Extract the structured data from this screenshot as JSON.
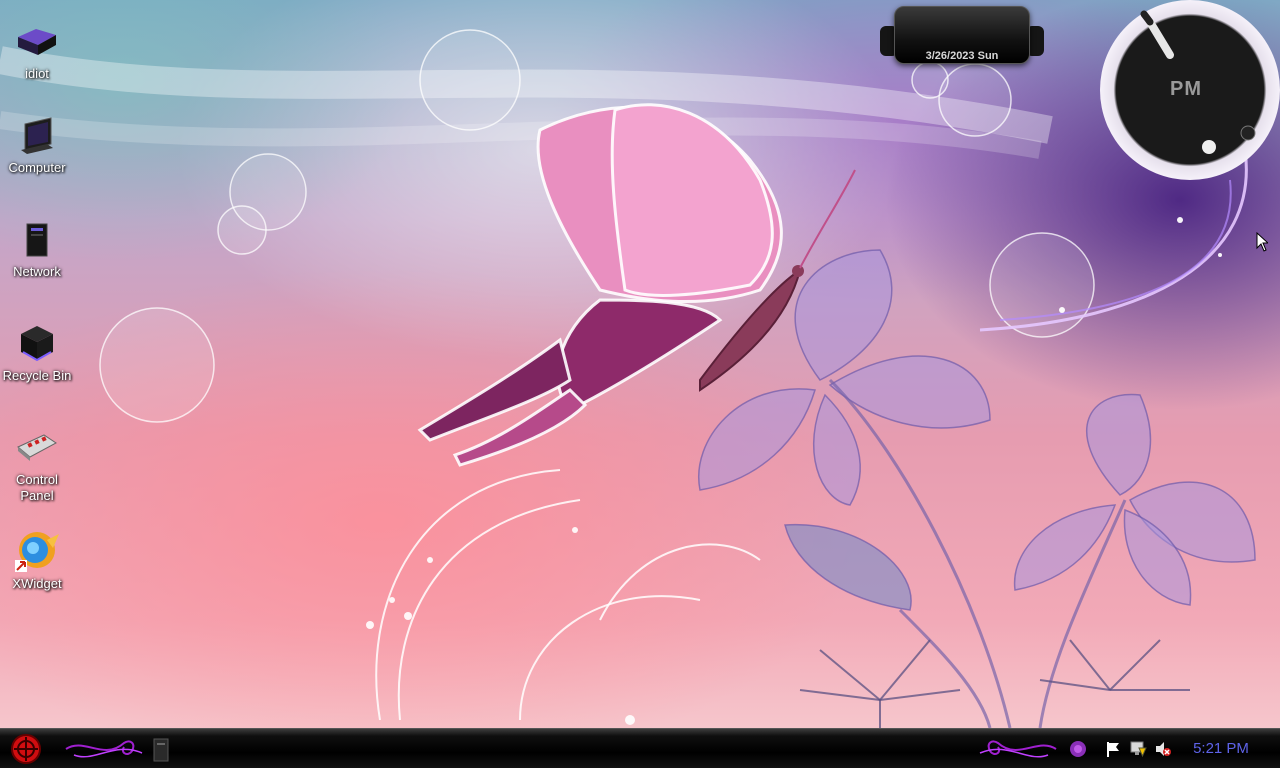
{
  "desktop": {
    "icons": [
      {
        "id": "idiot",
        "label": "idiot"
      },
      {
        "id": "computer",
        "label": "Computer"
      },
      {
        "id": "network",
        "label": "Network"
      },
      {
        "id": "recycle-bin",
        "label": "Recycle Bin"
      },
      {
        "id": "control-panel",
        "label": "Control\nPanel"
      },
      {
        "id": "xwidget",
        "label": "XWidget"
      }
    ]
  },
  "gadgets": {
    "date": {
      "text": "3/26/2023 Sun"
    },
    "clock": {
      "period": "PM"
    }
  },
  "taskbar": {
    "start_icon": "start-orb-icon",
    "tray_icons": [
      "flower-icon",
      "flag-icon",
      "network-icon",
      "volume-muted-icon"
    ],
    "time": "5:21 PM"
  },
  "colors": {
    "tray_time": "#5e63e8",
    "accent_purple": "#c040ff",
    "start_red": "#d10d10"
  }
}
